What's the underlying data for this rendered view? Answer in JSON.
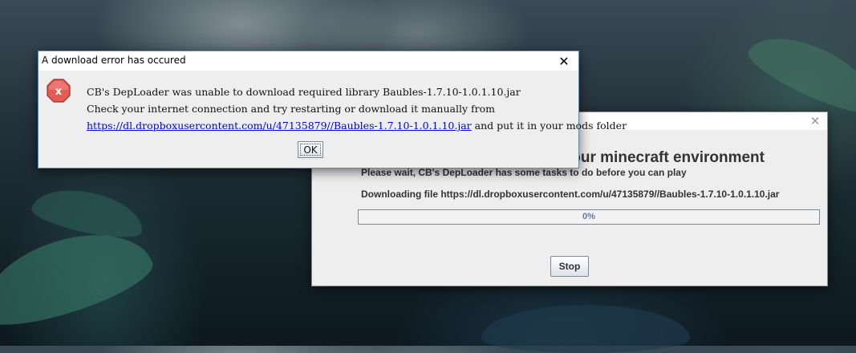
{
  "background_window": {
    "heading": "our minecraft environment",
    "wait_text": "Please wait, CB's DepLoader has some tasks to do before you can play",
    "download_text": "Downloading file https://dl.dropboxusercontent.com/u/47135879//Baubles-1.7.10-1.0.1.10.jar",
    "progress": {
      "value_percent": 0,
      "label": "0%"
    },
    "stop_label": "Stop",
    "close_icon": "close-icon"
  },
  "error_dialog": {
    "title": "A download error has occured",
    "icon": "error-stop-icon",
    "line1": "CB's DepLoader was unable to download required library Baubles-1.7.10-1.0.1.10.jar",
    "line2": "Check your internet connection and try restarting or download it manually from",
    "link": "https://dl.dropboxusercontent.com/u/47135879//Baubles-1.7.10-1.0.1.10.jar",
    "line3_suffix": " and put it in your mods folder",
    "ok_label": "OK",
    "close_icon": "close-icon"
  },
  "colors": {
    "dialog_bg": "#eeeeee",
    "link": "#0000ee",
    "progress_text": "#6379a6",
    "error_icon": "#d9534f"
  }
}
